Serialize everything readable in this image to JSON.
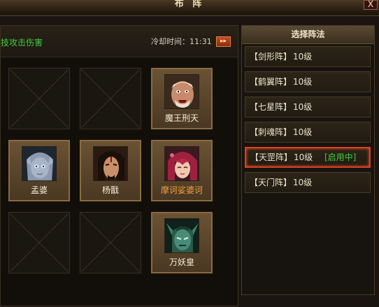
{
  "window": {
    "title": "布 阵",
    "close_label": "X"
  },
  "info_bar": {
    "skill_text": "技攻击伤害",
    "cooldown_text": "冷却时间：11:31",
    "cooldown_button": "▸▸"
  },
  "slots": [
    {
      "filled": false
    },
    {
      "filled": false
    },
    {
      "filled": true,
      "name": "魔王刑天",
      "icon": "demon-king-xingtian-portrait",
      "name_color": "#f4ecd8"
    },
    {
      "filled": true,
      "name": "孟婆",
      "icon": "meng-po-portrait",
      "name_color": "#f4ecd8"
    },
    {
      "filled": true,
      "name": "杨戬",
      "icon": "yang-jian-portrait",
      "name_color": "#f4ecd8"
    },
    {
      "filled": true,
      "name": "摩诃娑婆诃",
      "icon": "mohe-suopohe-portrait",
      "name_color": "#f0a040"
    },
    {
      "filled": false
    },
    {
      "filled": false
    },
    {
      "filled": true,
      "name": "万妖皇",
      "icon": "wan-yao-huang-portrait",
      "name_color": "#f4ecd8"
    }
  ],
  "formation_panel": {
    "header": "选择阵法",
    "formations": [
      {
        "name": "【剑形阵】",
        "level": "10级",
        "status": ""
      },
      {
        "name": "【鹤翼阵】",
        "level": "10级",
        "status": ""
      },
      {
        "name": "【七星阵】",
        "level": "10级",
        "status": ""
      },
      {
        "name": "【刺魂阵】",
        "level": "10级",
        "status": ""
      },
      {
        "name": "【天罡阵】",
        "level": "10级",
        "status": "[启用中]",
        "active": true
      },
      {
        "name": "【天门阵】",
        "level": "10级",
        "status": ""
      }
    ]
  }
}
